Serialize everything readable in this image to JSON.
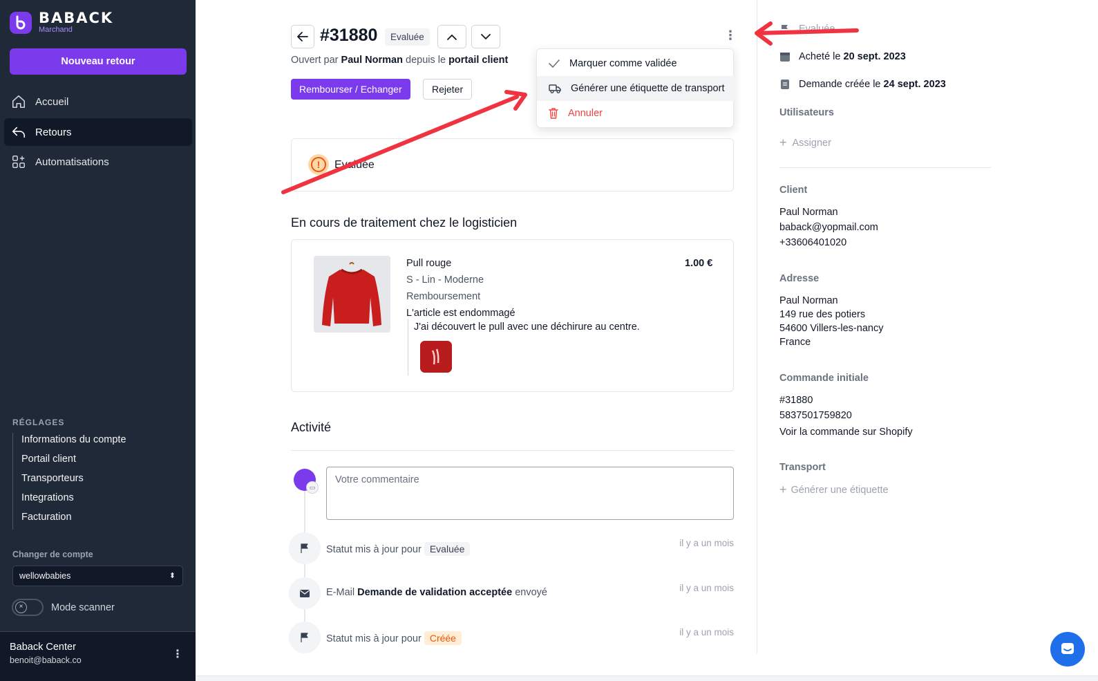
{
  "brand": {
    "name": "BABACK",
    "subtitle": "Marchand"
  },
  "sidebar": {
    "new_return_label": "Nouveau retour",
    "nav": [
      {
        "label": "Accueil",
        "icon": "home-icon"
      },
      {
        "label": "Retours",
        "icon": "return-arrow-icon",
        "active": true
      },
      {
        "label": "Automatisations",
        "icon": "grid-plus-icon"
      }
    ],
    "settings_title": "RÉGLAGES",
    "settings": [
      "Informations du compte",
      "Portail client",
      "Transporteurs",
      "Integrations",
      "Facturation"
    ],
    "switch_account_label": "Changer de compte",
    "account_value": "wellowbabies",
    "scanner_label": "Mode scanner",
    "user": {
      "name": "Baback Center",
      "email": "benoit@baback.co"
    }
  },
  "header": {
    "order_number": "#31880",
    "status": "Evaluée",
    "opened_prefix": "Ouvert par",
    "opened_by": "Paul Norman",
    "opened_middle": "depuis le",
    "opened_source": "portail client",
    "refund_label": "Rembourser / Echanger",
    "reject_label": "Rejeter"
  },
  "menu": {
    "items": [
      {
        "label": "Marquer comme validée",
        "icon": "check-icon"
      },
      {
        "label": "Générer une étiquette de transport",
        "icon": "truck-icon"
      },
      {
        "label": "Annuler",
        "icon": "trash-icon"
      }
    ]
  },
  "status_card": {
    "label": "Evaluée"
  },
  "items_section": {
    "title": "En cours de traitement chez le logisticien",
    "item": {
      "name": "Pull rouge",
      "price": "1.00 €",
      "variant": "S - Lin - Moderne",
      "type": "Remboursement",
      "reason": "L'article est endommagé",
      "comment": "J'ai découvert le pull avec une déchirure au centre."
    }
  },
  "activity": {
    "title": "Activité",
    "comment_placeholder": "Votre commentaire",
    "events": [
      {
        "prefix": "Statut mis à jour pour",
        "pill": "Evaluée",
        "time": "il y a un mois",
        "icon": "flag-icon"
      },
      {
        "prefix": "E-Mail",
        "bold": "Demande de validation acceptée",
        "suffix": "envoyé",
        "time": "il y a un mois",
        "icon": "mail-icon"
      },
      {
        "prefix": "Statut mis à jour pour",
        "pill": "Créée",
        "time": "il y a un mois",
        "icon": "flag-icon"
      }
    ]
  },
  "right_panel": {
    "status": "Evaluée",
    "purchased_prefix": "Acheté le",
    "purchased_date": "20 sept. 2023",
    "created_prefix": "Demande créée le",
    "created_date": "24 sept. 2023",
    "users_title": "Utilisateurs",
    "assign_label": "Assigner",
    "client_title": "Client",
    "client_name": "Paul Norman",
    "client_email": "baback@yopmail.com",
    "client_phone": "+33606401020",
    "address_title": "Adresse",
    "address_name": "Paul Norman",
    "address_line1": "149 rue des potiers",
    "address_line2": "54600 Villers-les-nancy",
    "address_country": "France",
    "order_title": "Commande initiale",
    "order_number": "#31880",
    "order_id": "5837501759820",
    "order_link": "Voir la commande sur Shopify",
    "transport_title": "Transport",
    "generate_label": "Générer une étiquette"
  },
  "colors": {
    "accent": "#7c3aed",
    "sidebar": "#1f2937",
    "danger": "#ef4444",
    "annotation": "#ef3340"
  }
}
